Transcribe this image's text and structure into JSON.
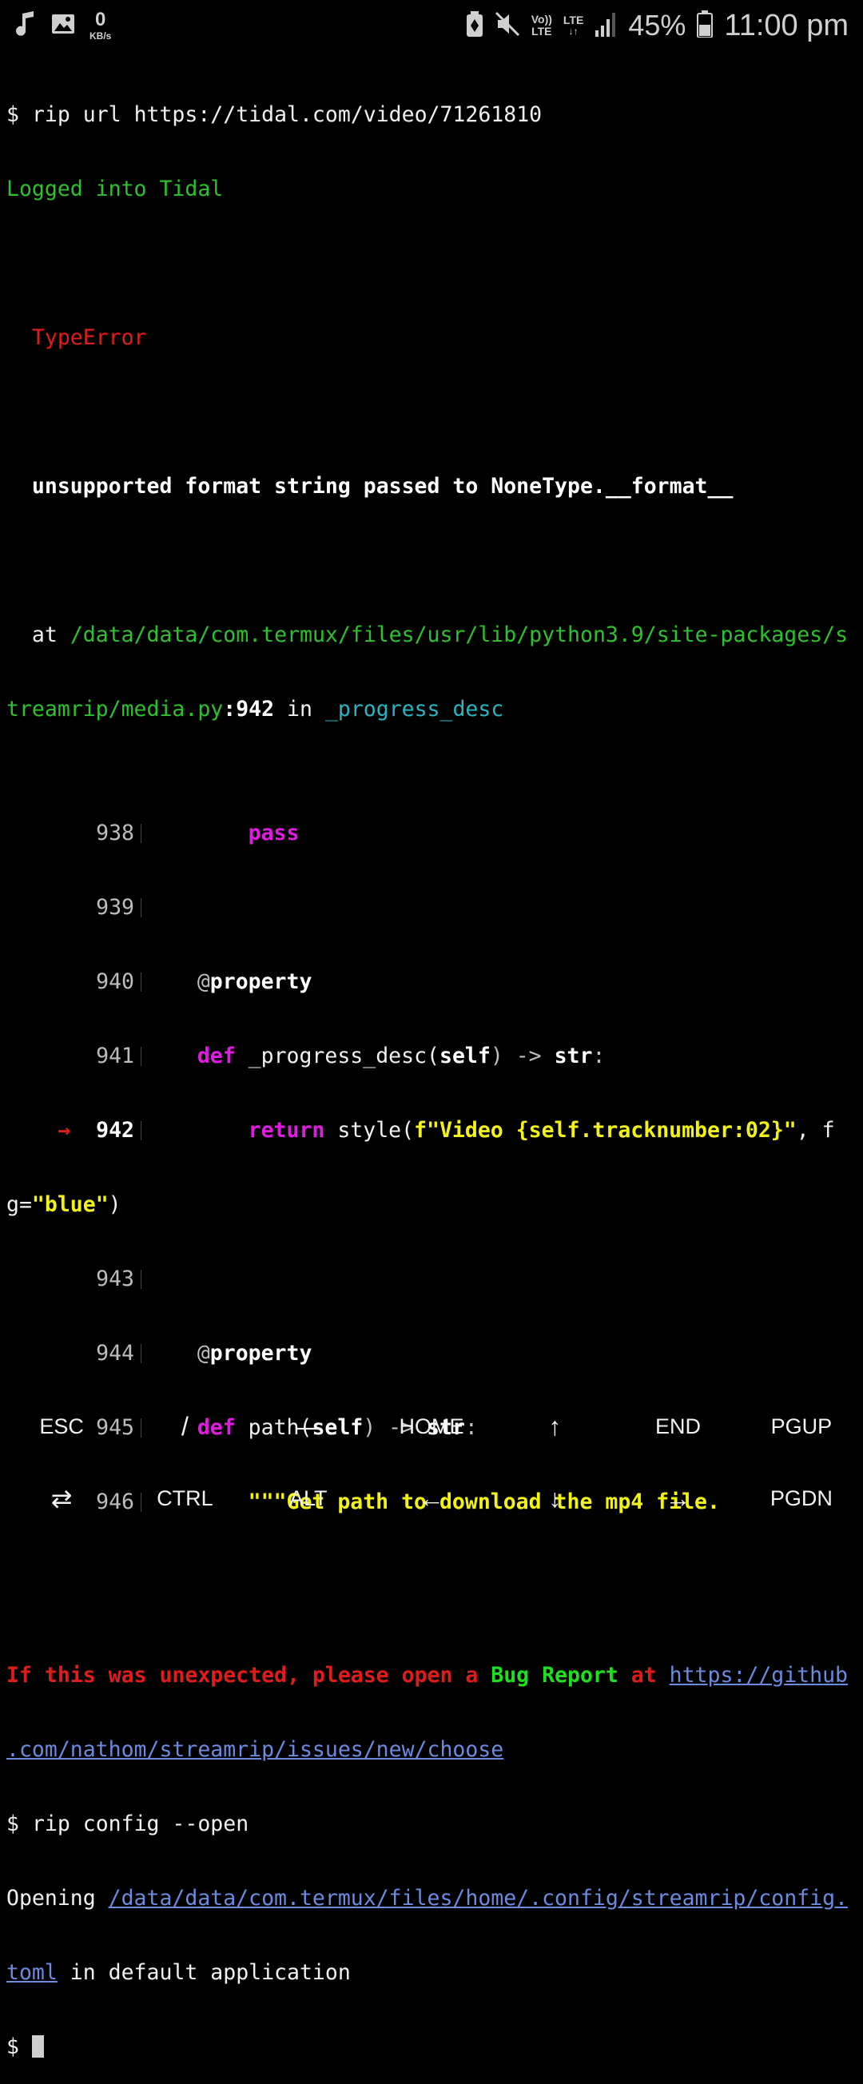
{
  "status_bar": {
    "left_icons": [
      "music-note-icon",
      "image-icon"
    ],
    "net_speed_value": "0",
    "net_speed_unit": "KB/s",
    "right_icons": [
      "battery-saver-icon",
      "mute-icon",
      "volte-icon",
      "lte-data-icon",
      "signal-icon",
      "battery-icon"
    ],
    "volte_label_top": "Vo))",
    "volte_label_bottom": "LTE",
    "lte_label": "LTE",
    "battery_percent": "45%",
    "time": "11:00 pm"
  },
  "terminal": {
    "prompt": "$",
    "cmd1": "rip url https://tidal.com/video/71261810",
    "logged_in": "Logged into Tidal",
    "error_type": "TypeError",
    "error_message": "unsupported format string passed to NoneType.__format__",
    "at_label": "at",
    "file_path_part1": "/data/data/com.termux/files/usr/lib/python3.9/site-packages/s",
    "file_path_part2": "treamrip/media.py",
    "colon_line": ":942",
    "in_label": "in",
    "func_name": "_progress_desc",
    "code_lines": [
      {
        "num": "938",
        "pre": "        ",
        "kw": "pass"
      },
      {
        "num": "939"
      },
      {
        "num": "940",
        "pre": "    @",
        "name": "property"
      },
      {
        "num": "941",
        "pre": "    ",
        "kw": "def",
        "sig": " _progress_desc(",
        "self": "self",
        "sig2": ") -> ",
        "ret": "str",
        "end": ":"
      },
      {
        "num": "942",
        "current": true,
        "arrow": "→",
        "pre": "        ",
        "kw": "return",
        "call": " style(",
        "fstr": "f\"Video {self.tracknumber:02}\"",
        "tail": ", f"
      },
      {
        "cont1": "g=",
        "cont_str": "\"blue\"",
        "cont2": ")"
      },
      {
        "num": "943"
      },
      {
        "num": "944",
        "pre": "    @",
        "name": "property"
      },
      {
        "num": "945",
        "pre": "    ",
        "kw": "def",
        "sig": " path(",
        "self": "self",
        "sig2": ") -> ",
        "ret": "str",
        "end": ":"
      },
      {
        "num": "946",
        "pre": "        ",
        "doc": "\"\"\"Get path to download the mp4 file."
      }
    ],
    "bug_text1": "If this was unexpected, please open a ",
    "bug_report": "Bug Report",
    "bug_at": " at ",
    "bug_url_part1": "https://github",
    "bug_url_part2": ".com/nathom/streamrip/issues/new/choose",
    "cmd2": "rip config --open",
    "opening_label": "Opening ",
    "config_path_part1": "/data/data/com.termux/files/home/.config/streamrip/config.",
    "config_path_part2": "toml",
    "opening_tail": " in default application"
  },
  "extra_keys": {
    "row1": [
      "ESC",
      "/",
      "—",
      "HOME",
      "↑",
      "END",
      "PGUP"
    ],
    "row2": [
      "⇄",
      "CTRL",
      "ALT",
      "←",
      "↓",
      "→",
      "PGDN"
    ]
  }
}
